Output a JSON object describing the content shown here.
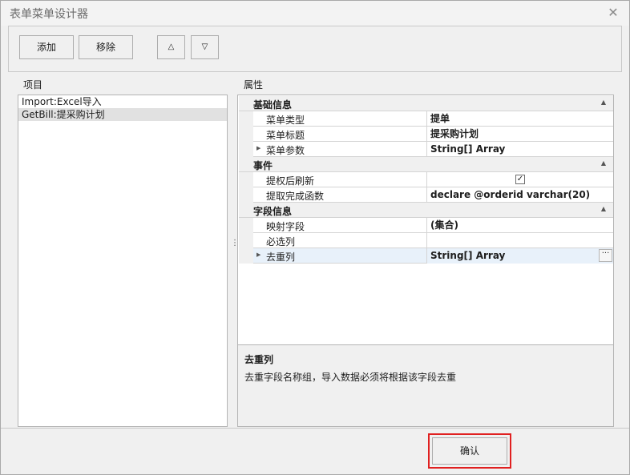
{
  "window": {
    "title": "表单菜单设计器",
    "close_glyph": "✕"
  },
  "toolbar": {
    "add_label": "添加",
    "remove_label": "移除",
    "move_up_glyph": "△",
    "move_down_glyph": "▽"
  },
  "items_panel": {
    "label": "项目",
    "items": [
      {
        "text": "Import:Excel导入",
        "selected": false
      },
      {
        "text": "GetBill:提采购计划",
        "selected": true
      }
    ]
  },
  "properties_panel": {
    "label": "属性",
    "categories": [
      {
        "name": "基础信息",
        "props": [
          {
            "name": "菜单类型",
            "value": "提单",
            "expandable": false
          },
          {
            "name": "菜单标题",
            "value": "提采购计划",
            "expandable": false
          },
          {
            "name": "菜单参数",
            "value": "String[] Array",
            "expandable": true
          }
        ]
      },
      {
        "name": "事件",
        "props": [
          {
            "name": "提权后刷新",
            "value": "",
            "checkbox": true,
            "checked": true
          },
          {
            "name": "提取完成函数",
            "value": "declare @orderid varchar(20)"
          }
        ]
      },
      {
        "name": "字段信息",
        "props": [
          {
            "name": "映射字段",
            "value": "(集合)"
          },
          {
            "name": "必选列",
            "value": ""
          },
          {
            "name": "去重列",
            "value": "String[] Array",
            "expandable": true,
            "selected": true
          }
        ]
      }
    ],
    "ellipsis_glyph": "···",
    "collapse_glyph": "▲",
    "expand_glyph": "▶",
    "check_glyph": "✓"
  },
  "description": {
    "title": "去重列",
    "text": "去重字段名称组，导入数据必须将根据该字段去重"
  },
  "footer": {
    "confirm_label": "确认"
  }
}
